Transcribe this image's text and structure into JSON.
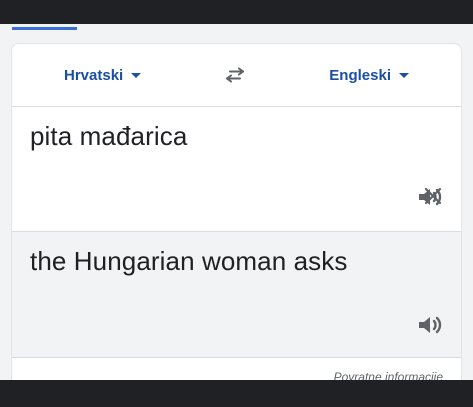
{
  "translator": {
    "source_language": "Hrvatski",
    "target_language": "Engleski",
    "source_text": "pita mađarica",
    "translated_text": "the Hungarian woman asks",
    "feedback_label": "Povratne informacije"
  },
  "icons": {
    "swap": "swap-languages-icon",
    "clear": "close-icon",
    "speaker": "speaker-icon",
    "dropdown": "chevron-down-icon"
  },
  "colors": {
    "accent": "#1a4fa3",
    "tab_indicator": "#3c6fd6",
    "target_pane": "#f1f3f4",
    "dark_bars": "#202124"
  }
}
